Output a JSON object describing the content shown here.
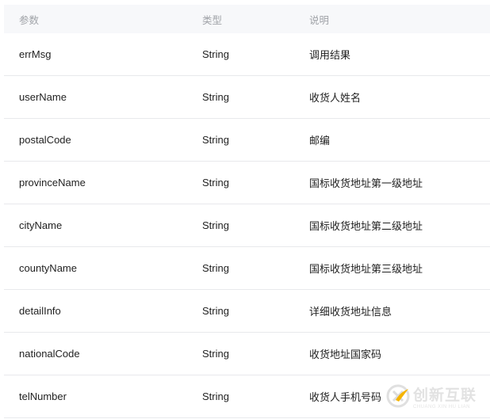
{
  "table": {
    "columns": [
      "参数",
      "类型",
      "说明"
    ],
    "rows": [
      [
        "errMsg",
        "String",
        "调用结果"
      ],
      [
        "userName",
        "String",
        "收货人姓名"
      ],
      [
        "postalCode",
        "String",
        "邮编"
      ],
      [
        "provinceName",
        "String",
        "国标收货地址第一级地址"
      ],
      [
        "cityName",
        "String",
        "国标收货地址第二级地址"
      ],
      [
        "countyName",
        "String",
        "国标收货地址第三级地址"
      ],
      [
        "detailInfo",
        "String",
        "详细收货地址信息"
      ],
      [
        "nationalCode",
        "String",
        "收货地址国家码"
      ],
      [
        "telNumber",
        "String",
        "收货人手机号码"
      ]
    ]
  },
  "watermark": {
    "name": "创新互联",
    "pinyin": "CHUANG XIN HU LIAN",
    "accent": "#f5b400"
  },
  "colors": {
    "header_bg": "#f7f8fa",
    "header_text": "#a0a3a8",
    "divider": "#e8e9ec"
  }
}
